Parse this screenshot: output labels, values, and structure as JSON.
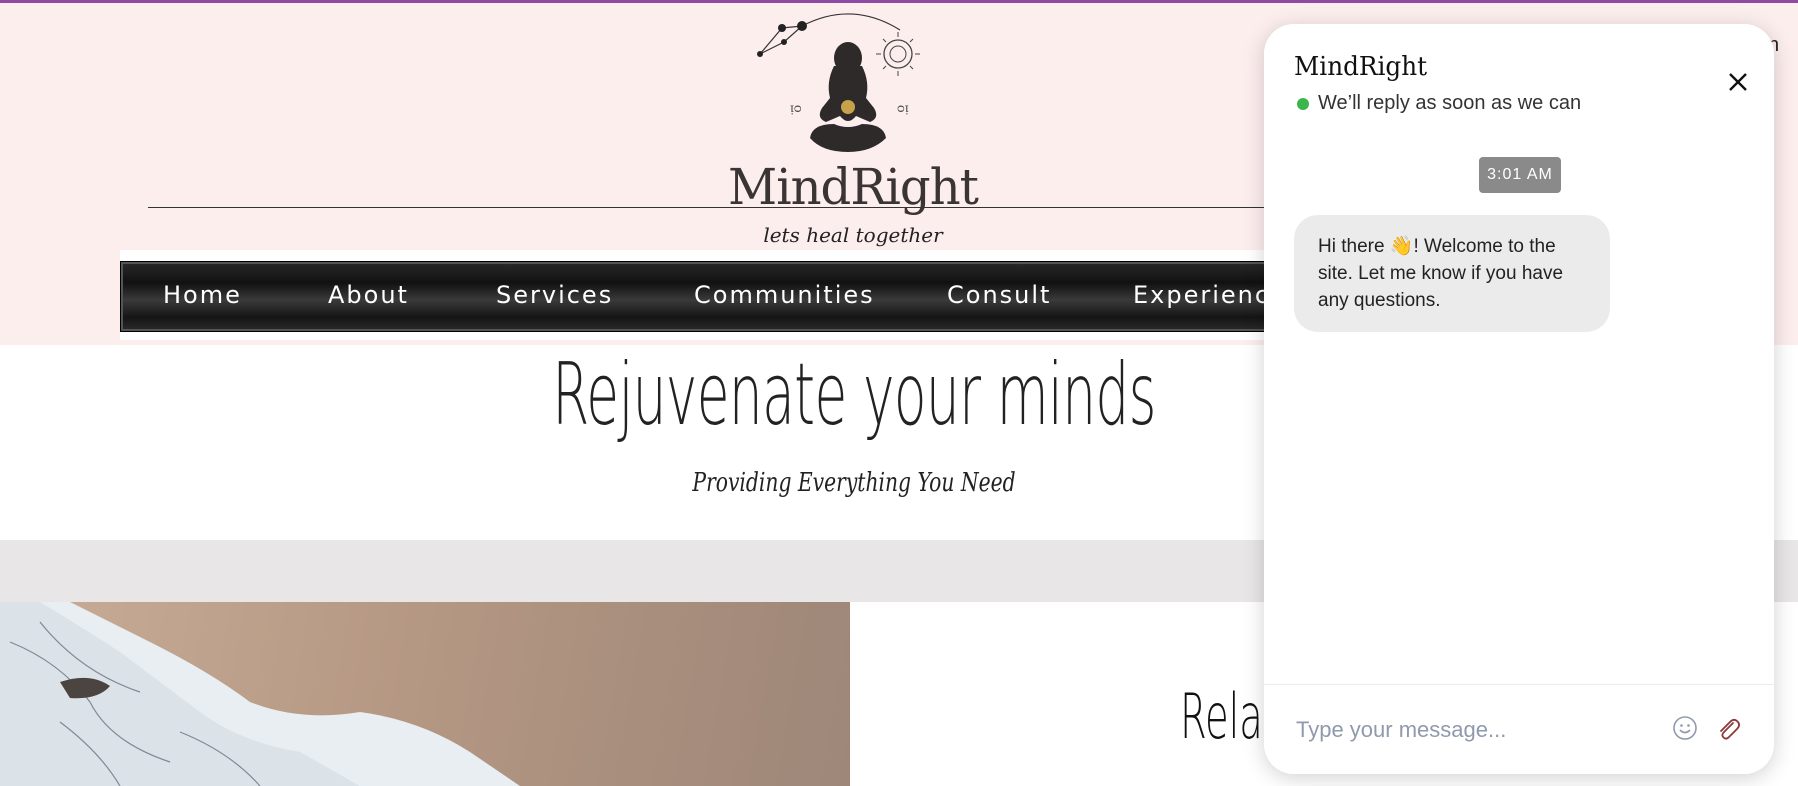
{
  "site": {
    "logo": {
      "name": "MindRight",
      "tagline": "lets heal together"
    },
    "nav": {
      "items": [
        "Home",
        "About",
        "Services",
        "Communities",
        "Consult",
        "Experience"
      ]
    },
    "hero": {
      "title": "Rejuvenate your minds",
      "subtitle": "Providing Everything You Need"
    },
    "section": {
      "heading": "Relax"
    },
    "cut_letter": "n"
  },
  "chat": {
    "title": "MindRight",
    "status": "We’ll reply as soon as we can",
    "timestamp": "3:01 AM",
    "message": "Hi there 👋! Welcome to the site. Let me know if you have any questions.",
    "input_placeholder": "Type your message..."
  },
  "colors": {
    "header_bg": "#fdeeee",
    "nav_bg": "#1a1a1a",
    "status_online": "#3cb64a",
    "top_accent": "#8e4aa5"
  }
}
